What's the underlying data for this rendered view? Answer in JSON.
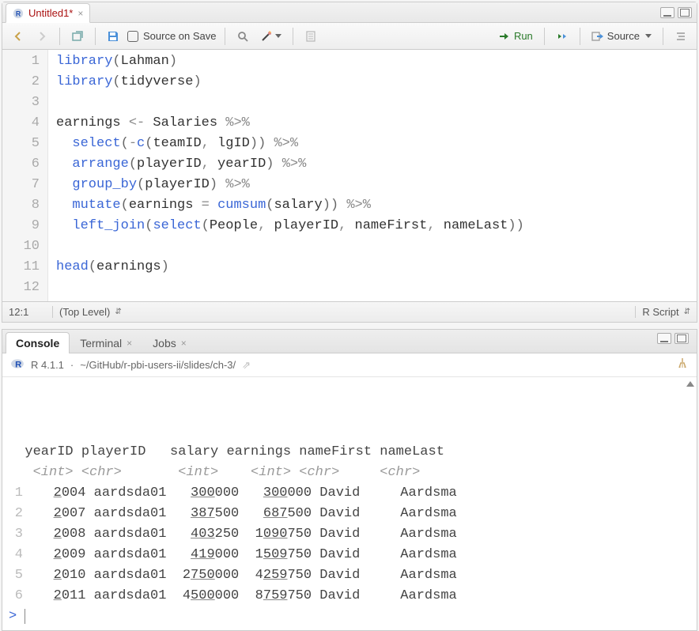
{
  "editor": {
    "tab_title": "Untitled1*",
    "toolbar": {
      "source_on_save_label": "Source on Save",
      "run_label": "Run",
      "source_label": "Source"
    },
    "code_lines": [
      {
        "n": 1,
        "tokens": [
          [
            "fn",
            "library"
          ],
          [
            "par",
            "("
          ],
          [
            "id",
            "Lahman"
          ],
          [
            "par",
            ")"
          ]
        ]
      },
      {
        "n": 2,
        "tokens": [
          [
            "fn",
            "library"
          ],
          [
            "par",
            "("
          ],
          [
            "id",
            "tidyverse"
          ],
          [
            "par",
            ")"
          ]
        ]
      },
      {
        "n": 3,
        "tokens": []
      },
      {
        "n": 4,
        "tokens": [
          [
            "id",
            "earnings "
          ],
          [
            "op",
            "<-"
          ],
          [
            "id",
            " Salaries "
          ],
          [
            "op",
            "%>%"
          ]
        ]
      },
      {
        "n": 5,
        "tokens": [
          [
            "id",
            "  "
          ],
          [
            "fn",
            "select"
          ],
          [
            "par",
            "("
          ],
          [
            "op",
            "-"
          ],
          [
            "fn",
            "c"
          ],
          [
            "par",
            "("
          ],
          [
            "id",
            "teamID"
          ],
          [
            "op",
            ","
          ],
          [
            "id",
            " lgID"
          ],
          [
            "par",
            "))"
          ],
          [
            "id",
            " "
          ],
          [
            "op",
            "%>%"
          ]
        ]
      },
      {
        "n": 6,
        "tokens": [
          [
            "id",
            "  "
          ],
          [
            "fn",
            "arrange"
          ],
          [
            "par",
            "("
          ],
          [
            "id",
            "playerID"
          ],
          [
            "op",
            ","
          ],
          [
            "id",
            " yearID"
          ],
          [
            "par",
            ")"
          ],
          [
            "id",
            " "
          ],
          [
            "op",
            "%>%"
          ]
        ]
      },
      {
        "n": 7,
        "tokens": [
          [
            "id",
            "  "
          ],
          [
            "fn",
            "group_by"
          ],
          [
            "par",
            "("
          ],
          [
            "id",
            "playerID"
          ],
          [
            "par",
            ")"
          ],
          [
            "id",
            " "
          ],
          [
            "op",
            "%>%"
          ]
        ]
      },
      {
        "n": 8,
        "tokens": [
          [
            "id",
            "  "
          ],
          [
            "fn",
            "mutate"
          ],
          [
            "par",
            "("
          ],
          [
            "id",
            "earnings "
          ],
          [
            "op",
            "="
          ],
          [
            "id",
            " "
          ],
          [
            "fn",
            "cumsum"
          ],
          [
            "par",
            "("
          ],
          [
            "id",
            "salary"
          ],
          [
            "par",
            "))"
          ],
          [
            "id",
            " "
          ],
          [
            "op",
            "%>%"
          ]
        ]
      },
      {
        "n": 9,
        "tokens": [
          [
            "id",
            "  "
          ],
          [
            "fn",
            "left_join"
          ],
          [
            "par",
            "("
          ],
          [
            "fn",
            "select"
          ],
          [
            "par",
            "("
          ],
          [
            "id",
            "People"
          ],
          [
            "op",
            ","
          ],
          [
            "id",
            " playerID"
          ],
          [
            "op",
            ","
          ],
          [
            "id",
            " nameFirst"
          ],
          [
            "op",
            ","
          ],
          [
            "id",
            " nameLast"
          ],
          [
            "par",
            "))"
          ]
        ]
      },
      {
        "n": 10,
        "tokens": []
      },
      {
        "n": 11,
        "tokens": [
          [
            "fn",
            "head"
          ],
          [
            "par",
            "("
          ],
          [
            "id",
            "earnings"
          ],
          [
            "par",
            ")"
          ]
        ]
      },
      {
        "n": 12,
        "tokens": []
      }
    ],
    "status": {
      "cursor": "12:1",
      "scope": "(Top Level)",
      "lang": "R Script"
    }
  },
  "console": {
    "tabs": [
      {
        "label": "Console",
        "active": true,
        "closable": false
      },
      {
        "label": "Terminal",
        "active": false,
        "closable": true
      },
      {
        "label": "Jobs",
        "active": false,
        "closable": true
      }
    ],
    "info": {
      "version": "R 4.1.1",
      "path": "~/GitHub/r-pbi-users-ii/slides/ch-3/"
    },
    "header": "  yearID playerID   salary earnings nameFirst nameLast",
    "types": "   <int> <chr>       <int>    <int> <chr>     <chr>   ",
    "rows": [
      {
        "n": "1",
        "yr_a": "2",
        "yr_b": "004",
        "pid": "aardsda01",
        "s_a": "  ",
        "s_u": "300",
        "s_b": "000",
        "e_a": "  ",
        "e_u": "300",
        "e_b": "000",
        "fn": "David",
        "ln": "Aardsma"
      },
      {
        "n": "2",
        "yr_a": "2",
        "yr_b": "007",
        "pid": "aardsda01",
        "s_a": "  ",
        "s_u": "387",
        "s_b": "500",
        "e_a": "  ",
        "e_u": "687",
        "e_b": "500",
        "fn": "David",
        "ln": "Aardsma"
      },
      {
        "n": "3",
        "yr_a": "2",
        "yr_b": "008",
        "pid": "aardsda01",
        "s_a": "  ",
        "s_u": "403",
        "s_b": "250",
        "e_a": " 1",
        "e_u": "090",
        "e_b": "750",
        "fn": "David",
        "ln": "Aardsma"
      },
      {
        "n": "4",
        "yr_a": "2",
        "yr_b": "009",
        "pid": "aardsda01",
        "s_a": "  ",
        "s_u": "419",
        "s_b": "000",
        "e_a": " 1",
        "e_u": "509",
        "e_b": "750",
        "fn": "David",
        "ln": "Aardsma"
      },
      {
        "n": "5",
        "yr_a": "2",
        "yr_b": "010",
        "pid": "aardsda01",
        "s_a": " 2",
        "s_u": "750",
        "s_b": "000",
        "e_a": " 4",
        "e_u": "259",
        "e_b": "750",
        "fn": "David",
        "ln": "Aardsma"
      },
      {
        "n": "6",
        "yr_a": "2",
        "yr_b": "011",
        "pid": "aardsda01",
        "s_a": " 4",
        "s_u": "500",
        "s_b": "000",
        "e_a": " 8",
        "e_u": "759",
        "e_b": "750",
        "fn": "David",
        "ln": "Aardsma"
      }
    ],
    "prompt": ">"
  }
}
